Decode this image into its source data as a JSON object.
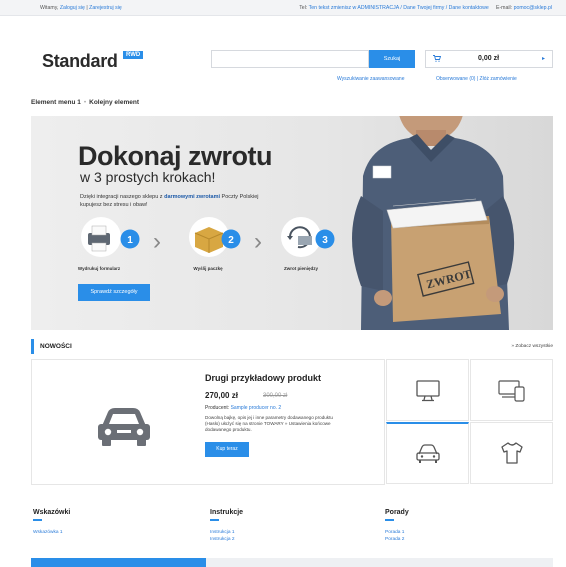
{
  "topbar": {
    "greeting": "Witamy,",
    "login": "Zaloguj się",
    "separator": "|",
    "register": "Zarejestruj się",
    "phone_label": "Tel:",
    "phone_text": "Ten tekst zmienisz w ADMINISTRACJA / Dane Twojej firmy / Dane kontaktowe",
    "email_label": "E-mail:",
    "email": "pomoc@sklep.pl"
  },
  "header": {
    "logo": "Standard",
    "logo_badge": "RWD",
    "search_button": "Szukaj",
    "search_placeholder": "",
    "advanced_search": "Wyszukiwanie zaawansowane",
    "cart_total": "0,00 zł",
    "cart_links": "Obserwowane (0) | Złóż zamówienie"
  },
  "menu": {
    "items": [
      "Element menu 1",
      "Kolejny element"
    ],
    "separator": "•"
  },
  "hero": {
    "title": "Dokonaj zwrotu",
    "subtitle": "w 3 prostych krokach!",
    "desc_before": "Dzięki integracji naszego sklepu z ",
    "desc_highlight": "darmowymi zwrotami",
    "desc_after": " Poczty Polskiej kupujesz bez stresu i obaw!",
    "steps": [
      {
        "num": "1",
        "label": "Wydrukuj formularz"
      },
      {
        "num": "2",
        "label": "Wyślij paczkę"
      },
      {
        "num": "3",
        "label": "Zwrot pieniędzy"
      }
    ],
    "button": "Sprawdź szczegóły",
    "box_label": "ZWROT"
  },
  "new_products": {
    "title": "NOWOŚCI",
    "see_all": "» Zobacz wszystkie"
  },
  "product": {
    "name": "Drugi przykładowy produkt",
    "price": "270,00 zł",
    "old_price": "300,00 zł",
    "producer_label": "Producent:",
    "producer": "Sample producer no. 2",
    "description": "Dowolną bajkę, opis jej i inne parametry dodawanego produktu (Hasło) ułożyć się na stronie TOWARY » Ustawienia końcowe dodawanego produktu.",
    "buy_button": "Kup teraz"
  },
  "categories": [
    {
      "icon": "monitor-icon"
    },
    {
      "icon": "devices-icon"
    },
    {
      "icon": "car-icon"
    },
    {
      "icon": "tshirt-icon"
    }
  ],
  "footer": {
    "columns": [
      {
        "title": "Wskazówki",
        "links": [
          "Wskazówka 1"
        ]
      },
      {
        "title": "Instrukcje",
        "links": [
          "Instrukcja 1",
          "Instrukcja 2"
        ]
      },
      {
        "title": "Porady",
        "links": [
          "Porada 1",
          "Porada 2"
        ]
      }
    ]
  },
  "colors": {
    "accent": "#2a8ee8",
    "link": "#2a7bd8"
  }
}
